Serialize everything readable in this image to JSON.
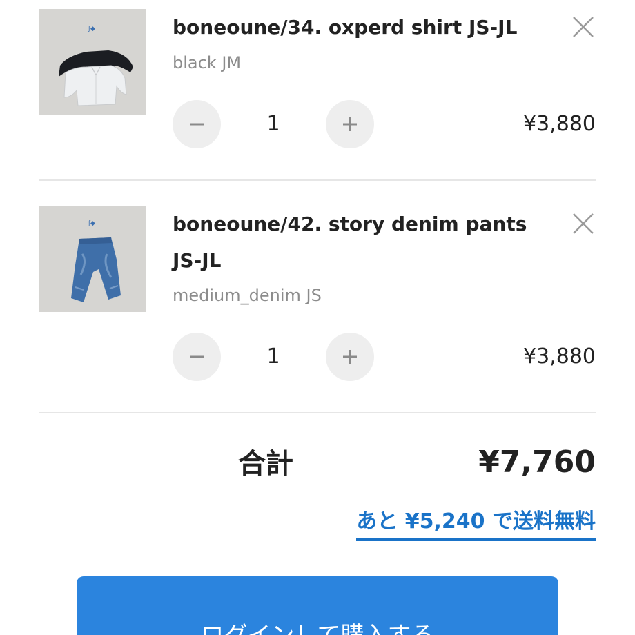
{
  "cart": {
    "items": [
      {
        "title": "boneoune/34. oxperd shirt JS-JL",
        "variant": "black JM",
        "quantity": "1",
        "price": "¥3,880",
        "thumbnail_icon": "shirt-photo"
      },
      {
        "title": "boneoune/42. story denim pants JS-JL",
        "variant": "medium_denim JS",
        "quantity": "1",
        "price": "¥3,880",
        "thumbnail_icon": "denim-pants-photo"
      }
    ],
    "total_label": "合計",
    "total_value": "¥7,760",
    "shipping_note": "あと ¥5,240 で送料無料",
    "checkout_label": "ログインして購入する"
  },
  "icons": {
    "remove": "close-icon",
    "decrement": "minus-icon",
    "increment": "plus-icon"
  },
  "colors": {
    "accent": "#2b84de",
    "link": "#1a73c8",
    "muted_text": "#8c8c8c",
    "stepper_bg": "#eeeeee"
  }
}
